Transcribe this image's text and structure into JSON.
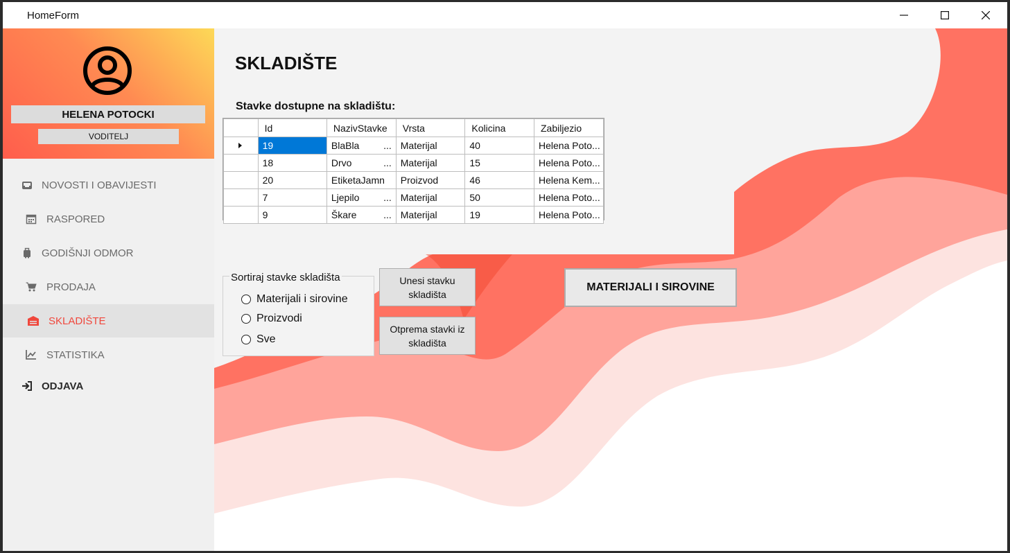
{
  "window": {
    "title": "HomeForm"
  },
  "user": {
    "name": "HELENA POTOCKI",
    "role": "VODITELJ"
  },
  "nav": [
    {
      "label": "NOVOSTI I OBAVIJESTI",
      "icon": "inbox-icon"
    },
    {
      "label": "RASPORED",
      "icon": "calendar-icon"
    },
    {
      "label": "GODIŠNJI ODMOR",
      "icon": "suitcase-icon"
    },
    {
      "label": "PRODAJA",
      "icon": "cart-icon"
    },
    {
      "label": "SKLADIŠTE",
      "icon": "warehouse-icon",
      "active": true
    },
    {
      "label": "STATISTIKA",
      "icon": "chart-line-icon"
    },
    {
      "label": "ODJAVA",
      "icon": "sign-out-icon"
    }
  ],
  "page": {
    "title": "SKLADIŠTE",
    "table_caption": "Stavke dostupne na skladištu:"
  },
  "table": {
    "columns": [
      "Id",
      "NazivStavke",
      "Vrsta",
      "Kolicina",
      "Zabiljezio"
    ],
    "rows": [
      [
        "19",
        "BlaBla",
        "Materijal",
        "40",
        "Helena Poto..."
      ],
      [
        "18",
        "Drvo",
        "Materijal",
        "15",
        "Helena Poto..."
      ],
      [
        "20",
        "EtiketaJamn...",
        "Proizvod",
        "46",
        "Helena Kem..."
      ],
      [
        "7",
        "Ljepilo",
        "Materijal",
        "50",
        "Helena Poto..."
      ],
      [
        "9",
        "Škare",
        "Materijal",
        "19",
        "Helena Poto..."
      ]
    ],
    "naziv_display": [
      "BlaBla",
      "Drvo",
      "EtiketaJamn",
      "Ljepilo",
      "Škare"
    ],
    "naziv_ellipsis": [
      "...",
      "...",
      "",
      "...",
      "..."
    ],
    "selected_row": 0
  },
  "sort": {
    "legend": "Sortiraj stavke skladišta",
    "options": [
      "Materijali i sirovine",
      "Proizvodi",
      "Sve"
    ]
  },
  "buttons": {
    "add": "Unesi stavku skladišta",
    "ship": "Otprema stavki iz skladišta",
    "filter": "MATERIJALI I SIROVINE"
  },
  "colors": {
    "accent": "#f0473c",
    "selection": "#0078d7",
    "gradient_start": "#ff5d4c",
    "gradient_end": "#fdd957"
  }
}
